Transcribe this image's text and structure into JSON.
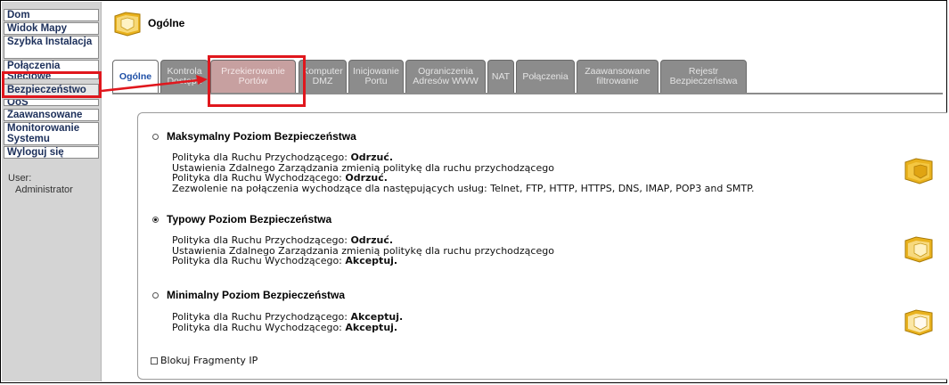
{
  "sidebar": {
    "items": [
      {
        "label": "Dom"
      },
      {
        "label": "Widok Mapy"
      },
      {
        "label": "Szybka Instalacja"
      },
      {
        "label": "Połączenia Sieciowe"
      },
      {
        "label": "Bezpieczeństwo"
      },
      {
        "label": "QoS"
      },
      {
        "label": "Zaawansowane"
      },
      {
        "label": "Monitorowanie Systemu"
      },
      {
        "label": "Wyloguj się"
      }
    ],
    "user_label": "User:",
    "user_value": "Administrator"
  },
  "header": {
    "title": "Ogólne"
  },
  "tabs": [
    {
      "label": "Ogólne"
    },
    {
      "label": "Kontrola Dostępu"
    },
    {
      "label": "Przekierowanie Portów"
    },
    {
      "label": "Komputer DMZ"
    },
    {
      "label": "Inicjowanie Portu"
    },
    {
      "label": "Ograniczenia Adresów WWW"
    },
    {
      "label": "NAT"
    },
    {
      "label": "Połączenia"
    },
    {
      "label": "Zaawansowane filtrowanie"
    },
    {
      "label": "Rejestr Bezpieczeństwa"
    }
  ],
  "levels": [
    {
      "title": "Maksymalny Poziom Bezpieczeństwa",
      "selected": false,
      "lines": [
        {
          "text": "Polityka dla Ruchu Przychodzącego: ",
          "value": "Odrzuć."
        },
        {
          "text": "Ustawienia Zdalnego Zarządzania zmienią politykę dla ruchu przychodzącego",
          "value": ""
        },
        {
          "text": "Polityka dla Ruchu Wychodzącego: ",
          "value": "Odrzuć."
        },
        {
          "text": "Zezwolenie na połączenia wychodzące dla następujących usług: Telnet, FTP, HTTP, HTTPS, DNS, IMAP, POP3 and SMTP.",
          "value": ""
        }
      ],
      "icon": "shield-full-icon"
    },
    {
      "title": "Typowy Poziom Bezpieczeństwa",
      "selected": true,
      "lines": [
        {
          "text": "Polityka dla Ruchu Przychodzącego: ",
          "value": "Odrzuć."
        },
        {
          "text": "Ustawienia Zdalnego Zarządzania zmienią politykę dla ruchu przychodzącego",
          "value": ""
        },
        {
          "text": "Polityka dla Ruchu Wychodzącego: ",
          "value": "Akceptuj."
        }
      ],
      "icon": "shield-medium-icon"
    },
    {
      "title": "Minimalny Poziom Bezpieczeństwa",
      "selected": false,
      "lines": [
        {
          "text": "Polityka dla Ruchu Przychodzącego: ",
          "value": "Akceptuj."
        },
        {
          "text": "Polityka dla Ruchu Wychodzącego: ",
          "value": "Akceptuj."
        }
      ],
      "icon": "shield-low-icon"
    }
  ],
  "checkbox": {
    "label": "Blokuj Fragmenty IP",
    "checked": false
  },
  "colors": {
    "annotation_red": "#e0171d",
    "tab_gray": "#8c8c8c",
    "link_blue": "#1e4fa6",
    "nav_text": "#1c2f5a"
  }
}
